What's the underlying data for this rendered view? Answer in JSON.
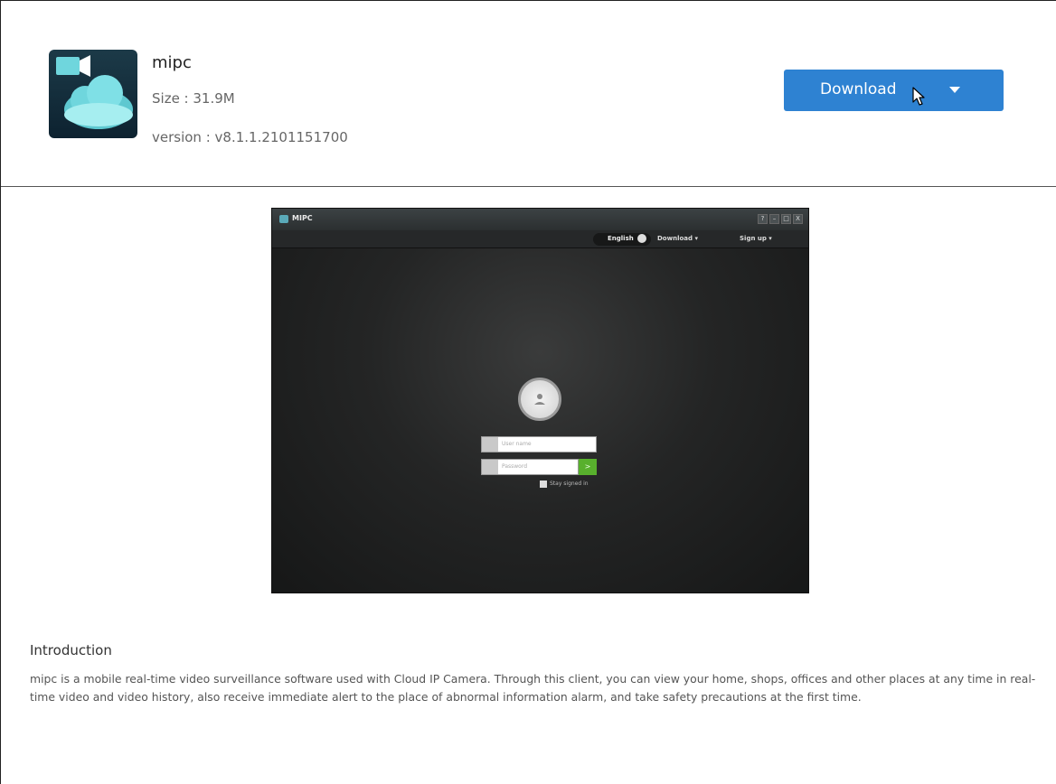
{
  "app": {
    "name": "mipc",
    "size": "Size : 31.9M",
    "version": "version : v8.1.1.2101151700"
  },
  "download_button": {
    "label": "Download",
    "color": "#2e82d2"
  },
  "preview": {
    "window_title": "MIPC",
    "window_buttons": [
      "?",
      "–",
      "□",
      "X"
    ],
    "menu": {
      "language": "English",
      "download": "Download ▾",
      "sign_up": "Sign up ▾"
    },
    "username_placeholder": "User name",
    "password_placeholder": "Password",
    "submit_glyph": ">",
    "stay_signed_in": "Stay signed in"
  },
  "introduction": {
    "title": "Introduction",
    "text": "mipc is a mobile real-time video surveillance software used with Cloud IP Camera. Through this client, you can view your home, shops, offices and other places at any time in real-time video and video history, also receive immediate alert to the place of abnormal information alarm, and take safety precautions at the first time."
  }
}
